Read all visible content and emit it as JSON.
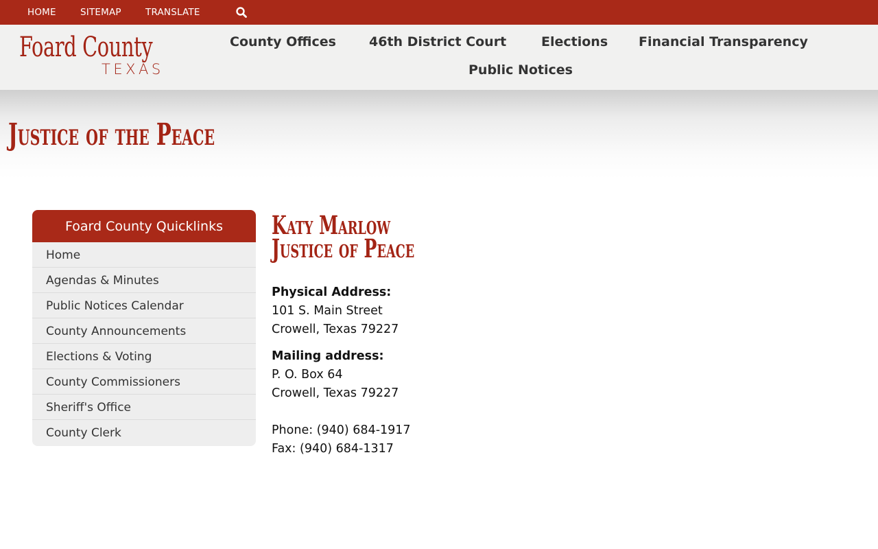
{
  "topbar": {
    "links": [
      "HOME",
      "SITEMAP",
      "TRANSLATE"
    ],
    "search_icon": "search-icon"
  },
  "logo": {
    "line1": "Foard County",
    "line2": "TEXAS"
  },
  "nav": {
    "items": [
      "County Offices",
      "46th District Court",
      "Elections",
      "Financial Transparency",
      "Public Notices"
    ]
  },
  "page": {
    "title": "Justice of the Peace"
  },
  "quicklinks": {
    "title": "Foard County Quicklinks",
    "items": [
      "Home",
      "Agendas & Minutes",
      "Public Notices Calendar",
      "County Announcements",
      "Elections & Voting",
      "County Commissioners",
      "Sheriff's Office",
      "County Clerk"
    ]
  },
  "contact": {
    "name": "Katy Marlow",
    "role": "Justice of Peace",
    "physical_label": "Physical Address:",
    "physical_line1": "101 S. Main Street",
    "physical_line2": "Crowell, Texas 79227",
    "mailing_label": "Mailing address:",
    "mailing_line1": "P. O. Box 64",
    "mailing_line2": "Crowell, Texas 79227",
    "phone": "Phone: (940) 684-1917",
    "fax": "Fax: (940) 684-1317"
  },
  "colors": {
    "brand_red": "#a92918",
    "header_bg": "#f1f1f0",
    "sidebar_bg": "#eeeeee"
  }
}
